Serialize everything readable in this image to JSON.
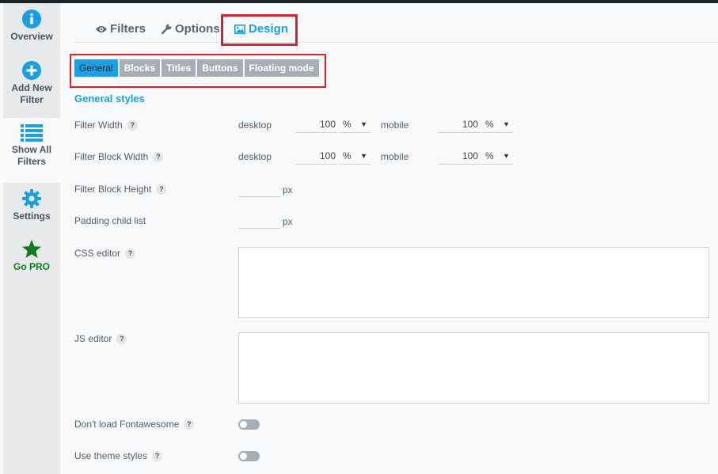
{
  "sidebar": {
    "items": [
      {
        "label": "Overview",
        "icon": "info-icon"
      },
      {
        "label": "Add New Filter",
        "icon": "plus-circle-icon"
      },
      {
        "label": "Show All Filters",
        "icon": "list-icon"
      },
      {
        "label": "Settings",
        "icon": "gear-icon"
      },
      {
        "label": "Go PRO",
        "icon": "star-icon"
      }
    ],
    "active_index": 2
  },
  "tabs": {
    "filters": "Filters",
    "options": "Options",
    "design": "Design",
    "active": "Design"
  },
  "subtabs": {
    "general": "General",
    "blocks": "Blocks",
    "titles": "Titles",
    "buttons": "Buttons",
    "floating": "Floating mode",
    "active": "General"
  },
  "section_title": "General styles",
  "help_glyph": "?",
  "fields": {
    "filter_width": {
      "label": "Filter Width",
      "desktop_label": "desktop",
      "desktop_value": "100",
      "desktop_unit": "%",
      "mobile_label": "mobile",
      "mobile_value": "100",
      "mobile_unit": "%"
    },
    "filter_block_width": {
      "label": "Filter Block Width",
      "desktop_label": "desktop",
      "desktop_value": "100",
      "desktop_unit": "%",
      "mobile_label": "mobile",
      "mobile_value": "100",
      "mobile_unit": "%"
    },
    "filter_block_height": {
      "label": "Filter Block Height",
      "unit": "px",
      "value": ""
    },
    "padding_child_list": {
      "label": "Padding child list",
      "unit": "px",
      "value": ""
    },
    "css_editor": {
      "label": "CSS editor",
      "value": ""
    },
    "js_editor": {
      "label": "JS editor",
      "value": ""
    },
    "dont_load_fontawesome": {
      "label": "Don't load Fontawesome",
      "enabled": false
    },
    "use_theme_styles": {
      "label": "Use theme styles",
      "enabled": false
    }
  },
  "colors": {
    "accent": "#1a9fe0",
    "highlight_frame": "#d4232f",
    "go_pro": "#0f7a1c"
  }
}
